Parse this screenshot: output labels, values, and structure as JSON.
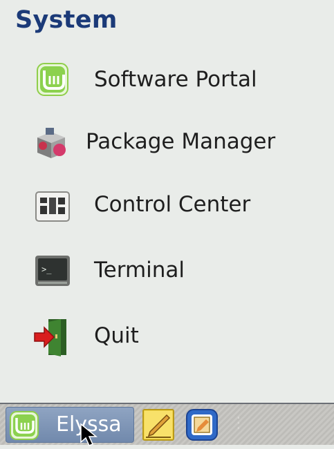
{
  "menu": {
    "section_title": "System",
    "items": [
      {
        "label": "Software Portal",
        "icon": "mint-software-icon"
      },
      {
        "label": "Package Manager",
        "icon": "package-manager-icon"
      },
      {
        "label": "Control Center",
        "icon": "control-center-icon"
      },
      {
        "label": "Terminal",
        "icon": "terminal-icon"
      },
      {
        "label": "Quit",
        "icon": "quit-icon"
      }
    ]
  },
  "taskbar": {
    "menu_button_label": "Elyssa",
    "launchers": [
      "text-editor-icon",
      "screenshot-icon"
    ]
  },
  "colors": {
    "section_title": "#1b3a78",
    "menu_background": "#e9ece9",
    "menu_button": "#7a90b3"
  }
}
